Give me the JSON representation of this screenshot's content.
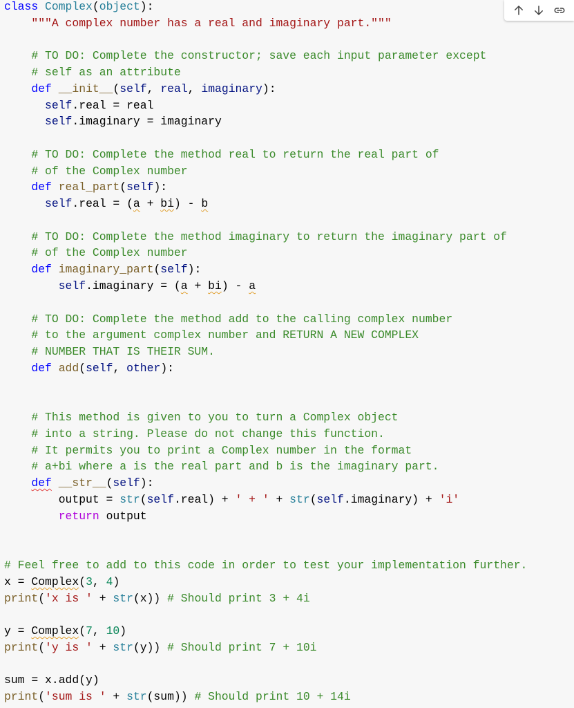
{
  "toolbar": {
    "buttons": [
      {
        "name": "move-cell-up",
        "icon": "arrow-up-icon"
      },
      {
        "name": "move-cell-down",
        "icon": "arrow-down-icon"
      },
      {
        "name": "link-to-cell",
        "icon": "link-icon"
      }
    ]
  },
  "code_lines": [
    [
      [
        "kw",
        "class"
      ],
      [
        "plain",
        " "
      ],
      [
        "cls",
        "Complex"
      ],
      [
        "plain",
        "("
      ],
      [
        "cls",
        "object"
      ],
      [
        "plain",
        "):"
      ]
    ],
    [
      [
        "plain",
        "    "
      ],
      [
        "str",
        "\"\"\"A complex number has a real and imaginary part.\"\"\""
      ]
    ],
    [],
    [
      [
        "plain",
        "    "
      ],
      [
        "com",
        "# TO DO: Complete the constructor; save each input parameter except"
      ]
    ],
    [
      [
        "plain",
        "    "
      ],
      [
        "com",
        "# self as an attribute"
      ]
    ],
    [
      [
        "plain",
        "    "
      ],
      [
        "kw",
        "def"
      ],
      [
        "plain",
        " "
      ],
      [
        "fn",
        "__init__"
      ],
      [
        "plain",
        "("
      ],
      [
        "self",
        "self"
      ],
      [
        "plain",
        ", "
      ],
      [
        "param",
        "real"
      ],
      [
        "plain",
        ", "
      ],
      [
        "param",
        "imaginary"
      ],
      [
        "plain",
        "):"
      ]
    ],
    [
      [
        "plain",
        "      "
      ],
      [
        "self",
        "self"
      ],
      [
        "plain",
        ".real = real"
      ]
    ],
    [
      [
        "plain",
        "      "
      ],
      [
        "self",
        "self"
      ],
      [
        "plain",
        ".imaginary = imaginary"
      ]
    ],
    [],
    [
      [
        "plain",
        "    "
      ],
      [
        "com",
        "# TO DO: Complete the method real to return the real part of"
      ]
    ],
    [
      [
        "plain",
        "    "
      ],
      [
        "com",
        "# of the Complex number"
      ]
    ],
    [
      [
        "plain",
        "    "
      ],
      [
        "kw",
        "def"
      ],
      [
        "plain",
        " "
      ],
      [
        "fn",
        "real_part"
      ],
      [
        "plain",
        "("
      ],
      [
        "self",
        "self"
      ],
      [
        "plain",
        "):"
      ]
    ],
    [
      [
        "plain",
        "      "
      ],
      [
        "self",
        "self"
      ],
      [
        "plain",
        ".real = ("
      ],
      [
        "warn",
        "a"
      ],
      [
        "plain",
        " + "
      ],
      [
        "warn",
        "bi"
      ],
      [
        "plain",
        ") - "
      ],
      [
        "warn",
        "b"
      ]
    ],
    [],
    [
      [
        "plain",
        "    "
      ],
      [
        "com",
        "# TO DO: Complete the method imaginary to return the imaginary part of"
      ]
    ],
    [
      [
        "plain",
        "    "
      ],
      [
        "com",
        "# of the Complex number"
      ]
    ],
    [
      [
        "plain",
        "    "
      ],
      [
        "kw",
        "def"
      ],
      [
        "plain",
        " "
      ],
      [
        "fn",
        "imaginary_part"
      ],
      [
        "plain",
        "("
      ],
      [
        "self",
        "self"
      ],
      [
        "plain",
        "):"
      ]
    ],
    [
      [
        "plain",
        "        "
      ],
      [
        "self",
        "self"
      ],
      [
        "plain",
        ".imaginary = ("
      ],
      [
        "warn",
        "a"
      ],
      [
        "plain",
        " + "
      ],
      [
        "warn",
        "bi"
      ],
      [
        "plain",
        ") - "
      ],
      [
        "warn",
        "a"
      ]
    ],
    [],
    [
      [
        "plain",
        "    "
      ],
      [
        "com",
        "# TO DO: Complete the method add to the calling complex number"
      ]
    ],
    [
      [
        "plain",
        "    "
      ],
      [
        "com",
        "# to the argument complex number and RETURN A NEW COMPLEX"
      ]
    ],
    [
      [
        "plain",
        "    "
      ],
      [
        "com",
        "# NUMBER THAT IS THEIR SUM."
      ]
    ],
    [
      [
        "plain",
        "    "
      ],
      [
        "kw",
        "def"
      ],
      [
        "plain",
        " "
      ],
      [
        "fn",
        "add"
      ],
      [
        "plain",
        "("
      ],
      [
        "self",
        "self"
      ],
      [
        "plain",
        ", "
      ],
      [
        "param",
        "other"
      ],
      [
        "plain",
        "):"
      ]
    ],
    [],
    [],
    [
      [
        "plain",
        "    "
      ],
      [
        "com",
        "# This method is given to you to turn a Complex object"
      ]
    ],
    [
      [
        "plain",
        "    "
      ],
      [
        "com",
        "# into a string. Please do not change this function."
      ]
    ],
    [
      [
        "plain",
        "    "
      ],
      [
        "com",
        "# It permits you to print a Complex number in the format"
      ]
    ],
    [
      [
        "plain",
        "    "
      ],
      [
        "com",
        "# a+bi where a is the real part and b is the imaginary part."
      ]
    ],
    [
      [
        "plain",
        "    "
      ],
      [
        "kwerr",
        "def"
      ],
      [
        "plain",
        " "
      ],
      [
        "fn",
        "__str__"
      ],
      [
        "plain",
        "("
      ],
      [
        "self",
        "self"
      ],
      [
        "plain",
        "):"
      ]
    ],
    [
      [
        "plain",
        "        output = "
      ],
      [
        "builtin",
        "str"
      ],
      [
        "plain",
        "("
      ],
      [
        "self",
        "self"
      ],
      [
        "plain",
        ".real) + "
      ],
      [
        "str",
        "' + '"
      ],
      [
        "plain",
        " + "
      ],
      [
        "builtin",
        "str"
      ],
      [
        "plain",
        "("
      ],
      [
        "self",
        "self"
      ],
      [
        "plain",
        ".imaginary) + "
      ],
      [
        "str",
        "'i'"
      ]
    ],
    [
      [
        "plain",
        "        "
      ],
      [
        "kw2",
        "return"
      ],
      [
        "plain",
        " output"
      ]
    ],
    [],
    [],
    [
      [
        "com",
        "# Feel free to add to this code in order to test your implementation further."
      ]
    ],
    [
      [
        "plain",
        "x = "
      ],
      [
        "warn",
        "Complex"
      ],
      [
        "plain",
        "("
      ],
      [
        "num",
        "3"
      ],
      [
        "plain",
        ", "
      ],
      [
        "num",
        "4"
      ],
      [
        "plain",
        ")"
      ]
    ],
    [
      [
        "fn",
        "print"
      ],
      [
        "plain",
        "("
      ],
      [
        "str",
        "'x is '"
      ],
      [
        "plain",
        " + "
      ],
      [
        "builtin",
        "str"
      ],
      [
        "plain",
        "(x)) "
      ],
      [
        "com",
        "# Should print 3 + 4i"
      ]
    ],
    [],
    [
      [
        "plain",
        "y = "
      ],
      [
        "warn",
        "Complex"
      ],
      [
        "plain",
        "("
      ],
      [
        "num",
        "7"
      ],
      [
        "plain",
        ", "
      ],
      [
        "num",
        "10"
      ],
      [
        "plain",
        ")"
      ]
    ],
    [
      [
        "fn",
        "print"
      ],
      [
        "plain",
        "("
      ],
      [
        "str",
        "'y is '"
      ],
      [
        "plain",
        " + "
      ],
      [
        "builtin",
        "str"
      ],
      [
        "plain",
        "(y)) "
      ],
      [
        "com",
        "# Should print 7 + 10i"
      ]
    ],
    [],
    [
      [
        "plain",
        "sum = x.add(y)"
      ]
    ],
    [
      [
        "fn",
        "print"
      ],
      [
        "plain",
        "("
      ],
      [
        "str",
        "'sum is '"
      ],
      [
        "plain",
        " + "
      ],
      [
        "builtin",
        "str"
      ],
      [
        "plain",
        "(sum)) "
      ],
      [
        "com",
        "# Should print 10 + 14i"
      ]
    ]
  ]
}
